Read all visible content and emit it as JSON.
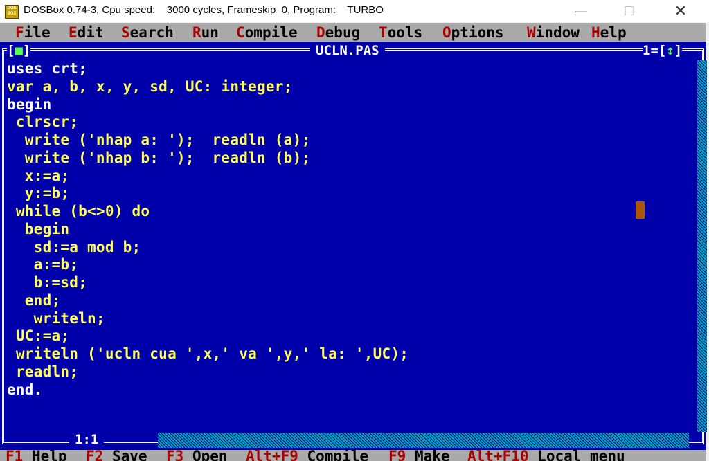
{
  "window": {
    "title": "DOSBox 0.74-3, Cpu speed:    3000 cycles, Frameskip  0, Program:    TURBO",
    "logo": "DOS BOX",
    "minimize": "—",
    "maximize": "☐",
    "close": "✕"
  },
  "menu": [
    {
      "hot": "F",
      "rest": "ile"
    },
    {
      "hot": "E",
      "rest": "dit"
    },
    {
      "hot": "S",
      "rest": "earch"
    },
    {
      "hot": "R",
      "rest": "un"
    },
    {
      "hot": "C",
      "rest": "ompile"
    },
    {
      "hot": "D",
      "rest": "ebug"
    },
    {
      "hot": "T",
      "rest": "ools"
    },
    {
      "hot": "O",
      "rest": "ptions"
    },
    {
      "hot": "W",
      "rest": "indow"
    },
    {
      "hot": "H",
      "rest": "elp"
    }
  ],
  "editor": {
    "filename": "UCLN.PAS",
    "window_number": "1=[",
    "zoom_glyph": "↕",
    "zoom_end": "]",
    "close_open": "[",
    "close_glyph": "■",
    "close_end": "]",
    "cursor_position": "1:1",
    "lines": [
      "uses crt;",
      "var a, b, x, y, sd, UC: integer;",
      "begin",
      " clrscr;",
      "  write ('nhap a: ');  readln (a);",
      "  write ('nhap b: ');  readln (b);",
      "  x:=a;",
      "  y:=b;",
      " while (b<>0) do",
      "  begin",
      "   sd:=a mod b;",
      "   a:=b;",
      "   b:=sd;",
      "  end;",
      "   writeln;",
      " UC:=a;",
      " writeln ('ucln cua ',x,' va ',y,' la: ',UC);",
      " readln;",
      "end."
    ],
    "colors": {
      "background": "#0000aa",
      "text": "#ffff55",
      "cursor": "#aa5500"
    }
  },
  "statusbar": [
    {
      "key": "F1",
      "label": "Help"
    },
    {
      "key": "F2",
      "label": "Save"
    },
    {
      "key": "F3",
      "label": "Open"
    },
    {
      "key": "Alt+F9",
      "label": "Compile"
    },
    {
      "key": "F9",
      "label": "Make"
    },
    {
      "key": "Alt+F10",
      "label": "Local menu"
    }
  ]
}
